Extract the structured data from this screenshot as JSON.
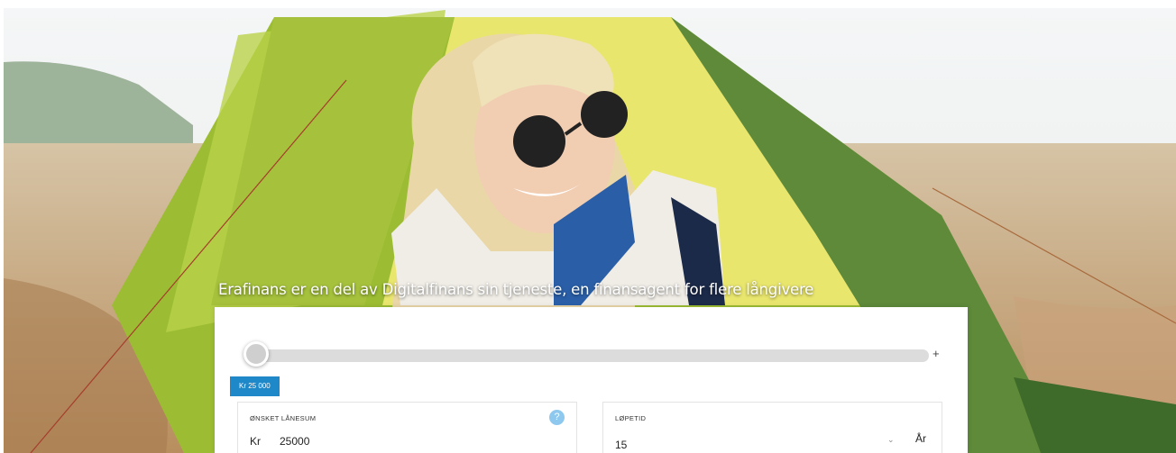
{
  "hero": {
    "tagline": "Erafinans er en del av Digitalfinans sin tjeneste, en finansagent for flere långivere"
  },
  "slider": {
    "plus_label": "+",
    "amount_badge": "Kr 25 000"
  },
  "loan_amount": {
    "label": "ØNSKET LÅNESUM",
    "currency": "Kr",
    "value": "25000",
    "help_icon": "?"
  },
  "term": {
    "label": "LØPETID",
    "value": "15",
    "unit": "År",
    "chevron": "⌄"
  },
  "colors": {
    "accent": "#1e88c9",
    "tent_green": "#9cbd33",
    "tent_yellow": "#e9e66e"
  }
}
